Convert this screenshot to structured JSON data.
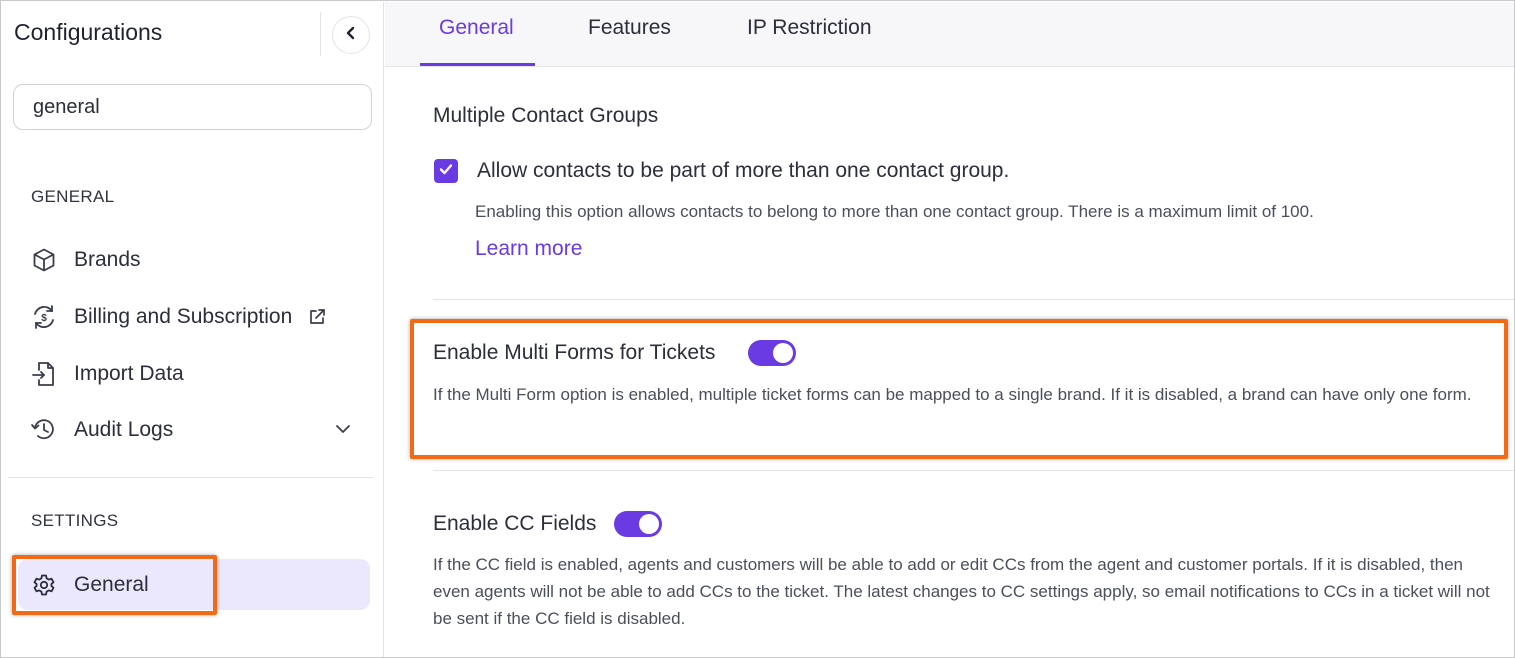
{
  "sidebar": {
    "title": "Configurations",
    "search_value": "general",
    "sections": {
      "general_label": "GENERAL",
      "settings_label": "SETTINGS"
    },
    "items": [
      {
        "label": "Brands",
        "icon": "cube-icon"
      },
      {
        "label": "Billing and Subscription",
        "icon": "billing-icon",
        "external": true
      },
      {
        "label": "Import Data",
        "icon": "import-icon"
      },
      {
        "label": "Audit Logs",
        "icon": "history-icon",
        "expandable": true
      }
    ],
    "settings_items": [
      {
        "label": "General",
        "icon": "gear-icon",
        "active": true
      }
    ]
  },
  "tabs": [
    {
      "label": "General",
      "active": true
    },
    {
      "label": "Features",
      "active": false
    },
    {
      "label": "IP Restriction",
      "active": false
    }
  ],
  "settings": {
    "contact_groups": {
      "title": "Multiple Contact Groups",
      "checkbox_label": "Allow contacts to be part of more than one contact group.",
      "checked": true,
      "description": "Enabling this option allows contacts to belong to more than one contact group. There is a maximum limit of 100.",
      "link": "Learn more"
    },
    "multi_forms": {
      "title": "Enable Multi Forms for Tickets",
      "enabled": true,
      "description": "If the Multi Form option is enabled, multiple ticket forms can be mapped to a single brand. If it is disabled, a brand can have only one form."
    },
    "cc_fields": {
      "title": "Enable CC Fields",
      "enabled": true,
      "description": "If the CC field is enabled, agents and customers will be able to add or edit CCs from the agent and customer portals. If it is disabled, then even agents will not be able to add CCs to the ticket. The latest changes to CC settings apply, so email notifications to CCs in a ticket will not be sent if the CC field is disabled."
    }
  },
  "colors": {
    "accent": "#6a3ae3",
    "highlight": "#f26a15",
    "active_nav_bg": "#ebe7fd"
  }
}
